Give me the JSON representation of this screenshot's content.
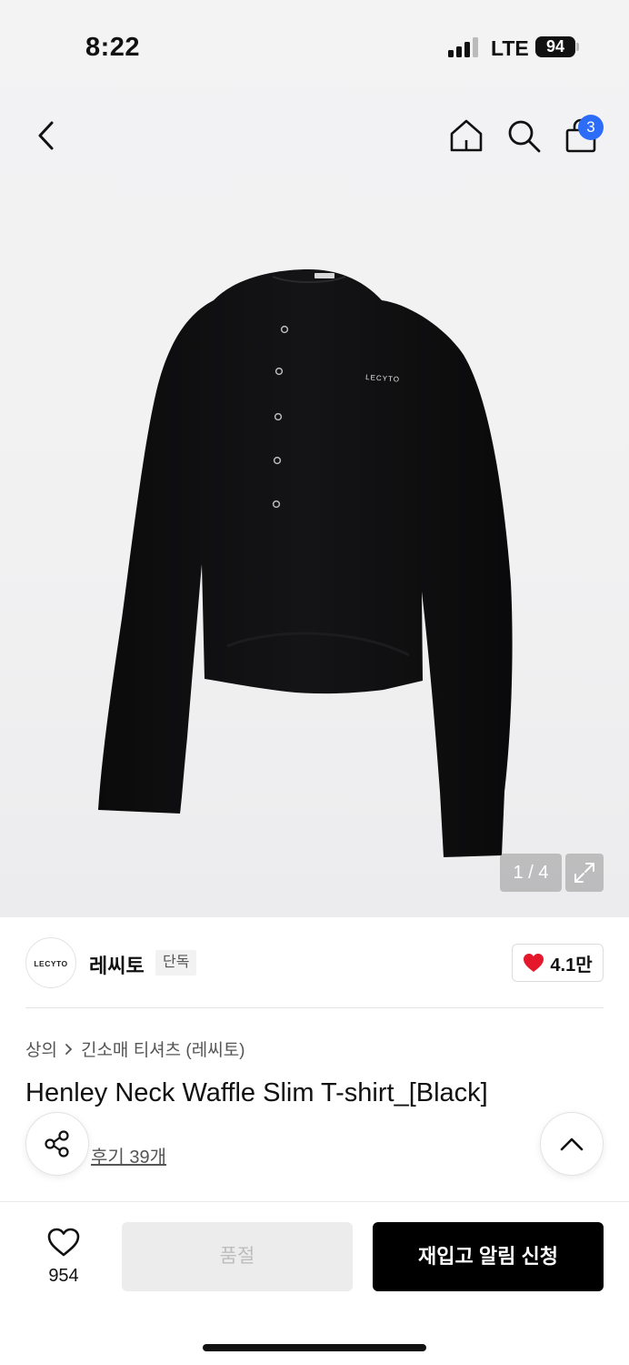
{
  "status_bar": {
    "time": "8:22",
    "network": "LTE",
    "battery": "94"
  },
  "header": {
    "back_icon": "chevron-left-icon",
    "home_icon": "home-icon",
    "search_icon": "search-icon",
    "cart_icon": "shopping-bag-icon",
    "cart_count": "3",
    "accent_color": "#2c6cf6"
  },
  "gallery": {
    "counter": "1 / 4",
    "expand_icon": "expand-icon",
    "product_logo_text": "LECYTO"
  },
  "brand": {
    "logo_text": "LECYTO",
    "name": "레씨토",
    "tag": "단독",
    "likes": "4.1만",
    "like_icon": "heart-filled-icon",
    "like_color": "#e4172b"
  },
  "product": {
    "breadcrumb": [
      "상의",
      "긴소매 티셔츠 (레씨토)"
    ],
    "title": "Henley Neck Waffle Slim T-shirt_[Black]",
    "review_link": "후기 39개"
  },
  "floating": {
    "share_icon": "share-icon",
    "top_icon": "chevron-up-icon"
  },
  "bottom_bar": {
    "wish_icon": "heart-outline-icon",
    "wish_count": "954",
    "soldout_label": "품절",
    "restock_label": "재입고 알림 신청"
  }
}
